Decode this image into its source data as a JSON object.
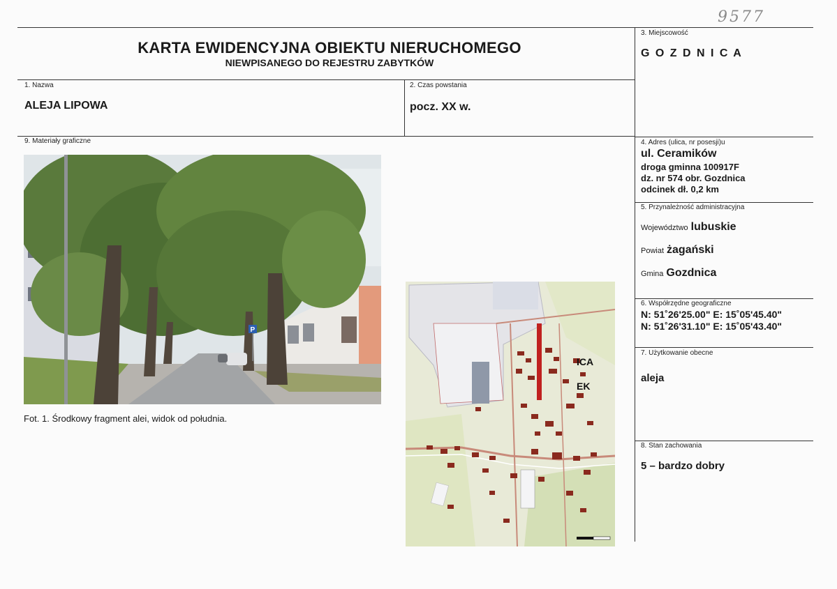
{
  "header": {
    "handwritten_number": "9577",
    "title": "KARTA EWIDENCYJNA OBIEKTU NIERUCHOMEGO",
    "subtitle": "NIEWPISANEGO DO REJESTRU ZABYTKÓW"
  },
  "fields": {
    "locality_label": "3. Miejscowość",
    "locality_value": "G O Z D N I C A",
    "name_label": "1. Nazwa",
    "name_value": "ALEJA LIPOWA",
    "period_label": "2. Czas powstania",
    "period_value": "pocz. XX w.",
    "graphics_label": "9. Materiały graficzne",
    "address_label": "4. Adres (ulica, nr posesji)u",
    "address_lines": [
      "ul. Ceramików",
      "droga gminna 100917F",
      "dz. nr 574 obr. Gozdnica",
      "odcinek dł. 0,2 km"
    ],
    "admin_label": "5. Przynależność administracyjna",
    "voivodeship_label": "Województwo",
    "voivodeship_value": "lubuskie",
    "county_label": "Powiat",
    "county_value": "żagański",
    "commune_label": "Gmina",
    "commune_value": "Gozdnica",
    "coords_label": "6. Współrzędne geograficzne",
    "coords_lines": [
      "N: 51˚26'25.00\"  E: 15˚05'45.40\"",
      "N: 51˚26'31.10\"  E: 15˚05'43.40\""
    ],
    "usage_label": "7. Użytkowanie obecne",
    "usage_value": "aleja",
    "condition_label": "8. Stan zachowania",
    "condition_value": "5 – bardzo dobry"
  },
  "photo": {
    "caption": "Fot. 1. Środkowy fragment alei, widok od południa.",
    "parking_sign": "P"
  },
  "map": {
    "labels": [
      "ICA",
      "EK"
    ]
  }
}
